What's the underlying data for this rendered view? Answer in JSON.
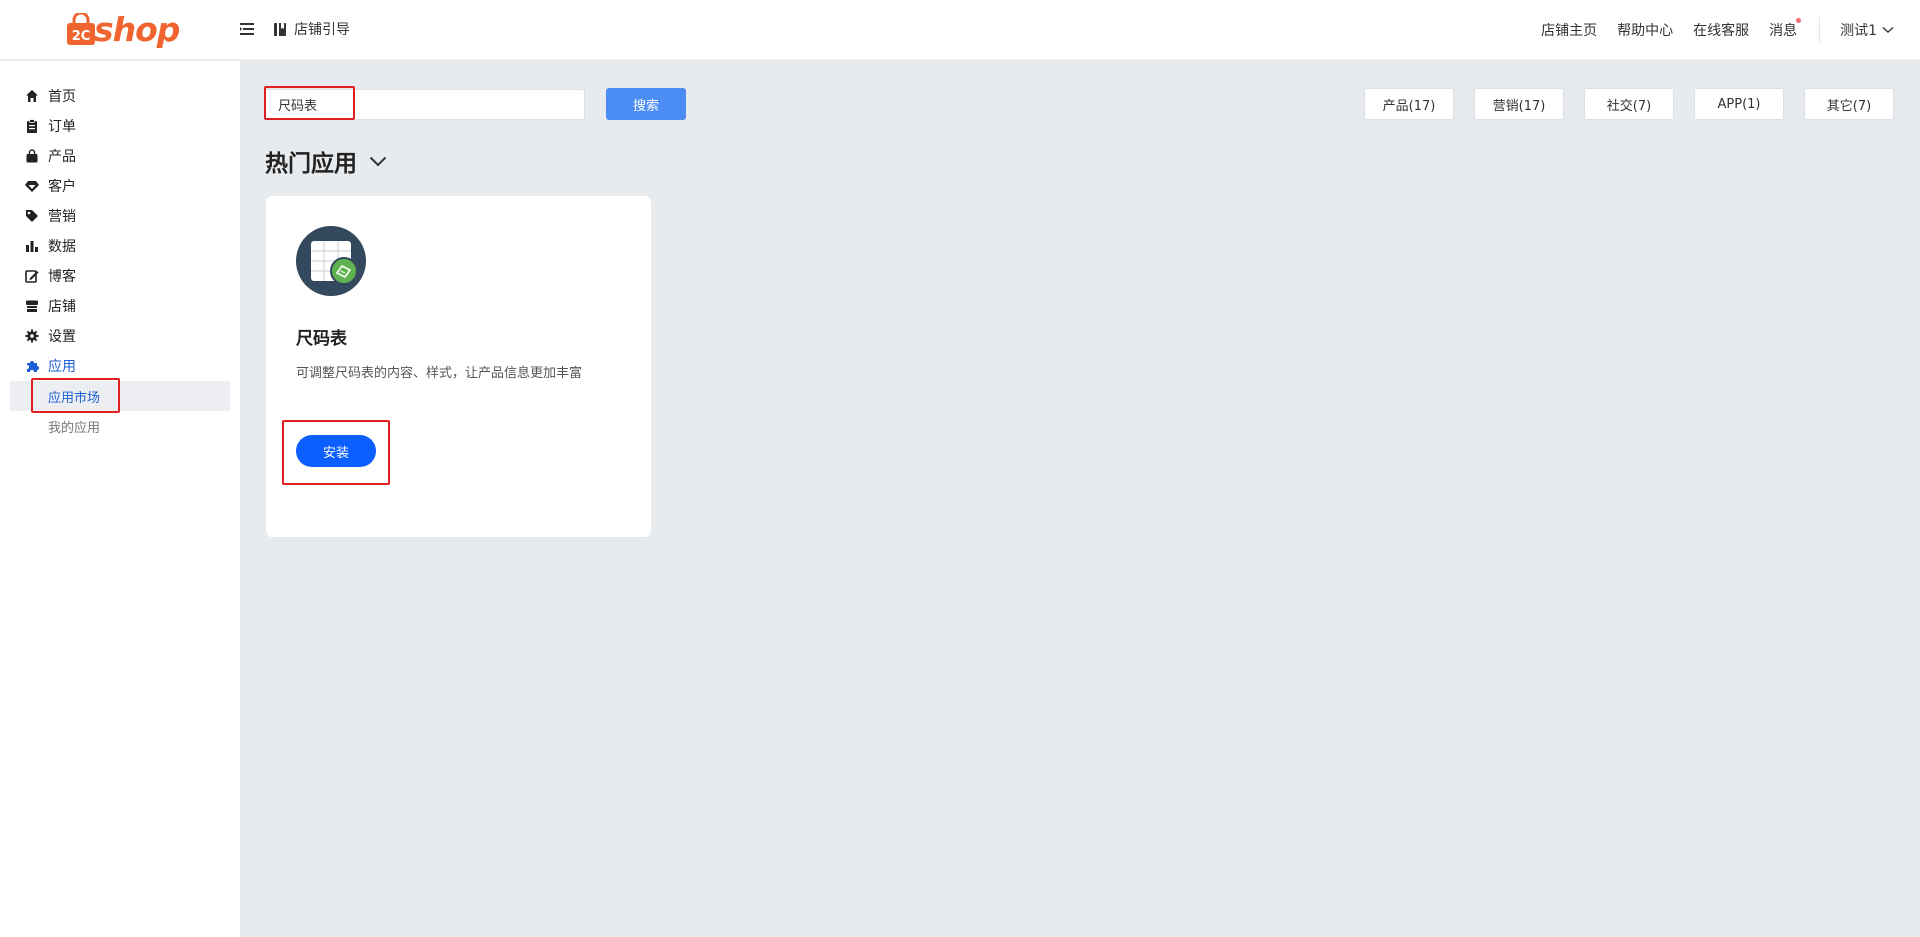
{
  "header": {
    "logo_text": "shop",
    "logo_mark_text": "2C",
    "guide_label": "店铺引导",
    "nav": [
      "店铺主页",
      "帮助中心",
      "在线客服",
      "消息"
    ],
    "user_name": "测试1"
  },
  "sidebar": {
    "items": [
      {
        "label": "首页",
        "icon": "home-icon"
      },
      {
        "label": "订单",
        "icon": "clipboard-icon"
      },
      {
        "label": "产品",
        "icon": "shopping-bag-icon"
      },
      {
        "label": "客户",
        "icon": "gem-icon"
      },
      {
        "label": "营销",
        "icon": "tag-icon"
      },
      {
        "label": "数据",
        "icon": "bar-chart-icon"
      },
      {
        "label": "博客",
        "icon": "edit-icon"
      },
      {
        "label": "店铺",
        "icon": "store-icon"
      },
      {
        "label": "设置",
        "icon": "gear-icon"
      },
      {
        "label": "应用",
        "icon": "puzzle-icon"
      }
    ],
    "sub_items": [
      "应用市场",
      "我的应用"
    ]
  },
  "search": {
    "value": "尺码表",
    "button_label": "搜索"
  },
  "categories": [
    "产品(17)",
    "营销(17)",
    "社交(7)",
    "APP(1)",
    "其它(7)"
  ],
  "section": {
    "title": "热门应用"
  },
  "app": {
    "name": "尺码表",
    "description": "可调整尺码表的内容、样式，让产品信息更加丰富",
    "install_label": "安装"
  },
  "colors": {
    "brand": "#f0652f",
    "primary": "#0b5fff",
    "search_button": "#4b8cf5",
    "active_menu": "#1f5fd6",
    "highlight": "#e02020"
  }
}
